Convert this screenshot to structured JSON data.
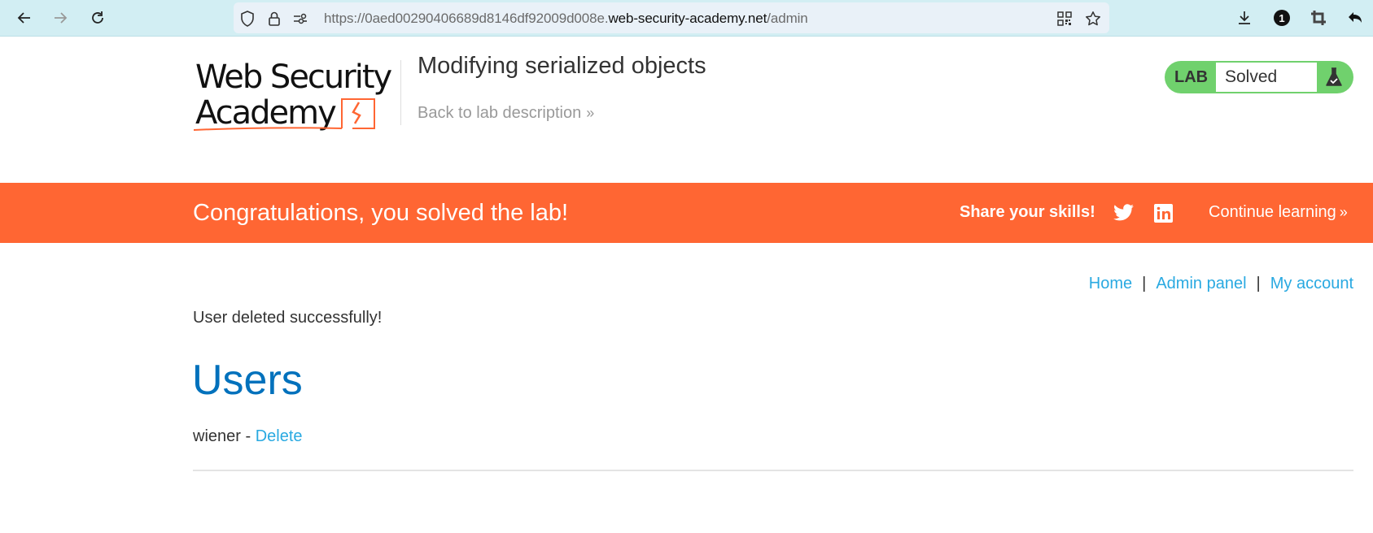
{
  "browser": {
    "url_prefix": "https://0aed00290406689d8146df92009d008e.",
    "url_host": "web-security-academy.net",
    "url_path": "/admin",
    "extensions_badge": "1",
    "icons": [
      "back-arrow-icon",
      "forward-arrow-icon",
      "reload-icon",
      "shield-icon",
      "lock-icon",
      "site-settings-icon",
      "qr-code-icon",
      "bookmark-star-icon",
      "download-icon",
      "extension-badge-icon",
      "crop-icon",
      "undo-icon"
    ]
  },
  "header": {
    "logo_line1": "Web Security",
    "logo_line2": "Academy",
    "lab_title": "Modifying serialized objects",
    "back_link": "Back to lab description",
    "back_chevron": "»",
    "lab_badge_label": "LAB",
    "lab_status": "Solved"
  },
  "banner": {
    "message": "Congratulations, you solved the lab!",
    "share_label": "Share your skills!",
    "continue_label": "Continue learning",
    "continue_chevron": "»",
    "color": "#ff6633"
  },
  "nav": {
    "links": [
      {
        "label": "Home"
      },
      {
        "label": "Admin panel"
      },
      {
        "label": "My account"
      }
    ],
    "separator": "|"
  },
  "main": {
    "status_message": "User deleted successfully!",
    "heading": "Users",
    "users": [
      {
        "name": "wiener",
        "separator": " - ",
        "action": "Delete"
      }
    ]
  },
  "colors": {
    "link": "#29a9e1",
    "heading": "#0071bc",
    "solved": "#70d16d"
  }
}
